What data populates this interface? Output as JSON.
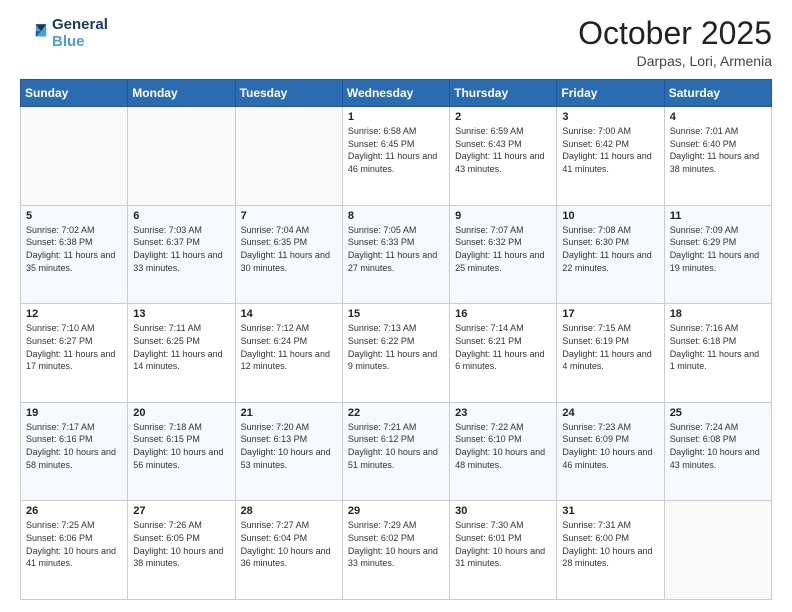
{
  "header": {
    "logo_line1": "General",
    "logo_line2": "Blue",
    "month": "October 2025",
    "location": "Darpas, Lori, Armenia"
  },
  "days_of_week": [
    "Sunday",
    "Monday",
    "Tuesday",
    "Wednesday",
    "Thursday",
    "Friday",
    "Saturday"
  ],
  "weeks": [
    [
      {
        "day": "",
        "sunrise": "",
        "sunset": "",
        "daylight": ""
      },
      {
        "day": "",
        "sunrise": "",
        "sunset": "",
        "daylight": ""
      },
      {
        "day": "",
        "sunrise": "",
        "sunset": "",
        "daylight": ""
      },
      {
        "day": "1",
        "sunrise": "Sunrise: 6:58 AM",
        "sunset": "Sunset: 6:45 PM",
        "daylight": "Daylight: 11 hours and 46 minutes."
      },
      {
        "day": "2",
        "sunrise": "Sunrise: 6:59 AM",
        "sunset": "Sunset: 6:43 PM",
        "daylight": "Daylight: 11 hours and 43 minutes."
      },
      {
        "day": "3",
        "sunrise": "Sunrise: 7:00 AM",
        "sunset": "Sunset: 6:42 PM",
        "daylight": "Daylight: 11 hours and 41 minutes."
      },
      {
        "day": "4",
        "sunrise": "Sunrise: 7:01 AM",
        "sunset": "Sunset: 6:40 PM",
        "daylight": "Daylight: 11 hours and 38 minutes."
      }
    ],
    [
      {
        "day": "5",
        "sunrise": "Sunrise: 7:02 AM",
        "sunset": "Sunset: 6:38 PM",
        "daylight": "Daylight: 11 hours and 35 minutes."
      },
      {
        "day": "6",
        "sunrise": "Sunrise: 7:03 AM",
        "sunset": "Sunset: 6:37 PM",
        "daylight": "Daylight: 11 hours and 33 minutes."
      },
      {
        "day": "7",
        "sunrise": "Sunrise: 7:04 AM",
        "sunset": "Sunset: 6:35 PM",
        "daylight": "Daylight: 11 hours and 30 minutes."
      },
      {
        "day": "8",
        "sunrise": "Sunrise: 7:05 AM",
        "sunset": "Sunset: 6:33 PM",
        "daylight": "Daylight: 11 hours and 27 minutes."
      },
      {
        "day": "9",
        "sunrise": "Sunrise: 7:07 AM",
        "sunset": "Sunset: 6:32 PM",
        "daylight": "Daylight: 11 hours and 25 minutes."
      },
      {
        "day": "10",
        "sunrise": "Sunrise: 7:08 AM",
        "sunset": "Sunset: 6:30 PM",
        "daylight": "Daylight: 11 hours and 22 minutes."
      },
      {
        "day": "11",
        "sunrise": "Sunrise: 7:09 AM",
        "sunset": "Sunset: 6:29 PM",
        "daylight": "Daylight: 11 hours and 19 minutes."
      }
    ],
    [
      {
        "day": "12",
        "sunrise": "Sunrise: 7:10 AM",
        "sunset": "Sunset: 6:27 PM",
        "daylight": "Daylight: 11 hours and 17 minutes."
      },
      {
        "day": "13",
        "sunrise": "Sunrise: 7:11 AM",
        "sunset": "Sunset: 6:25 PM",
        "daylight": "Daylight: 11 hours and 14 minutes."
      },
      {
        "day": "14",
        "sunrise": "Sunrise: 7:12 AM",
        "sunset": "Sunset: 6:24 PM",
        "daylight": "Daylight: 11 hours and 12 minutes."
      },
      {
        "day": "15",
        "sunrise": "Sunrise: 7:13 AM",
        "sunset": "Sunset: 6:22 PM",
        "daylight": "Daylight: 11 hours and 9 minutes."
      },
      {
        "day": "16",
        "sunrise": "Sunrise: 7:14 AM",
        "sunset": "Sunset: 6:21 PM",
        "daylight": "Daylight: 11 hours and 6 minutes."
      },
      {
        "day": "17",
        "sunrise": "Sunrise: 7:15 AM",
        "sunset": "Sunset: 6:19 PM",
        "daylight": "Daylight: 11 hours and 4 minutes."
      },
      {
        "day": "18",
        "sunrise": "Sunrise: 7:16 AM",
        "sunset": "Sunset: 6:18 PM",
        "daylight": "Daylight: 11 hours and 1 minute."
      }
    ],
    [
      {
        "day": "19",
        "sunrise": "Sunrise: 7:17 AM",
        "sunset": "Sunset: 6:16 PM",
        "daylight": "Daylight: 10 hours and 58 minutes."
      },
      {
        "day": "20",
        "sunrise": "Sunrise: 7:18 AM",
        "sunset": "Sunset: 6:15 PM",
        "daylight": "Daylight: 10 hours and 56 minutes."
      },
      {
        "day": "21",
        "sunrise": "Sunrise: 7:20 AM",
        "sunset": "Sunset: 6:13 PM",
        "daylight": "Daylight: 10 hours and 53 minutes."
      },
      {
        "day": "22",
        "sunrise": "Sunrise: 7:21 AM",
        "sunset": "Sunset: 6:12 PM",
        "daylight": "Daylight: 10 hours and 51 minutes."
      },
      {
        "day": "23",
        "sunrise": "Sunrise: 7:22 AM",
        "sunset": "Sunset: 6:10 PM",
        "daylight": "Daylight: 10 hours and 48 minutes."
      },
      {
        "day": "24",
        "sunrise": "Sunrise: 7:23 AM",
        "sunset": "Sunset: 6:09 PM",
        "daylight": "Daylight: 10 hours and 46 minutes."
      },
      {
        "day": "25",
        "sunrise": "Sunrise: 7:24 AM",
        "sunset": "Sunset: 6:08 PM",
        "daylight": "Daylight: 10 hours and 43 minutes."
      }
    ],
    [
      {
        "day": "26",
        "sunrise": "Sunrise: 7:25 AM",
        "sunset": "Sunset: 6:06 PM",
        "daylight": "Daylight: 10 hours and 41 minutes."
      },
      {
        "day": "27",
        "sunrise": "Sunrise: 7:26 AM",
        "sunset": "Sunset: 6:05 PM",
        "daylight": "Daylight: 10 hours and 38 minutes."
      },
      {
        "day": "28",
        "sunrise": "Sunrise: 7:27 AM",
        "sunset": "Sunset: 6:04 PM",
        "daylight": "Daylight: 10 hours and 36 minutes."
      },
      {
        "day": "29",
        "sunrise": "Sunrise: 7:29 AM",
        "sunset": "Sunset: 6:02 PM",
        "daylight": "Daylight: 10 hours and 33 minutes."
      },
      {
        "day": "30",
        "sunrise": "Sunrise: 7:30 AM",
        "sunset": "Sunset: 6:01 PM",
        "daylight": "Daylight: 10 hours and 31 minutes."
      },
      {
        "day": "31",
        "sunrise": "Sunrise: 7:31 AM",
        "sunset": "Sunset: 6:00 PM",
        "daylight": "Daylight: 10 hours and 28 minutes."
      },
      {
        "day": "",
        "sunrise": "",
        "sunset": "",
        "daylight": ""
      }
    ]
  ]
}
